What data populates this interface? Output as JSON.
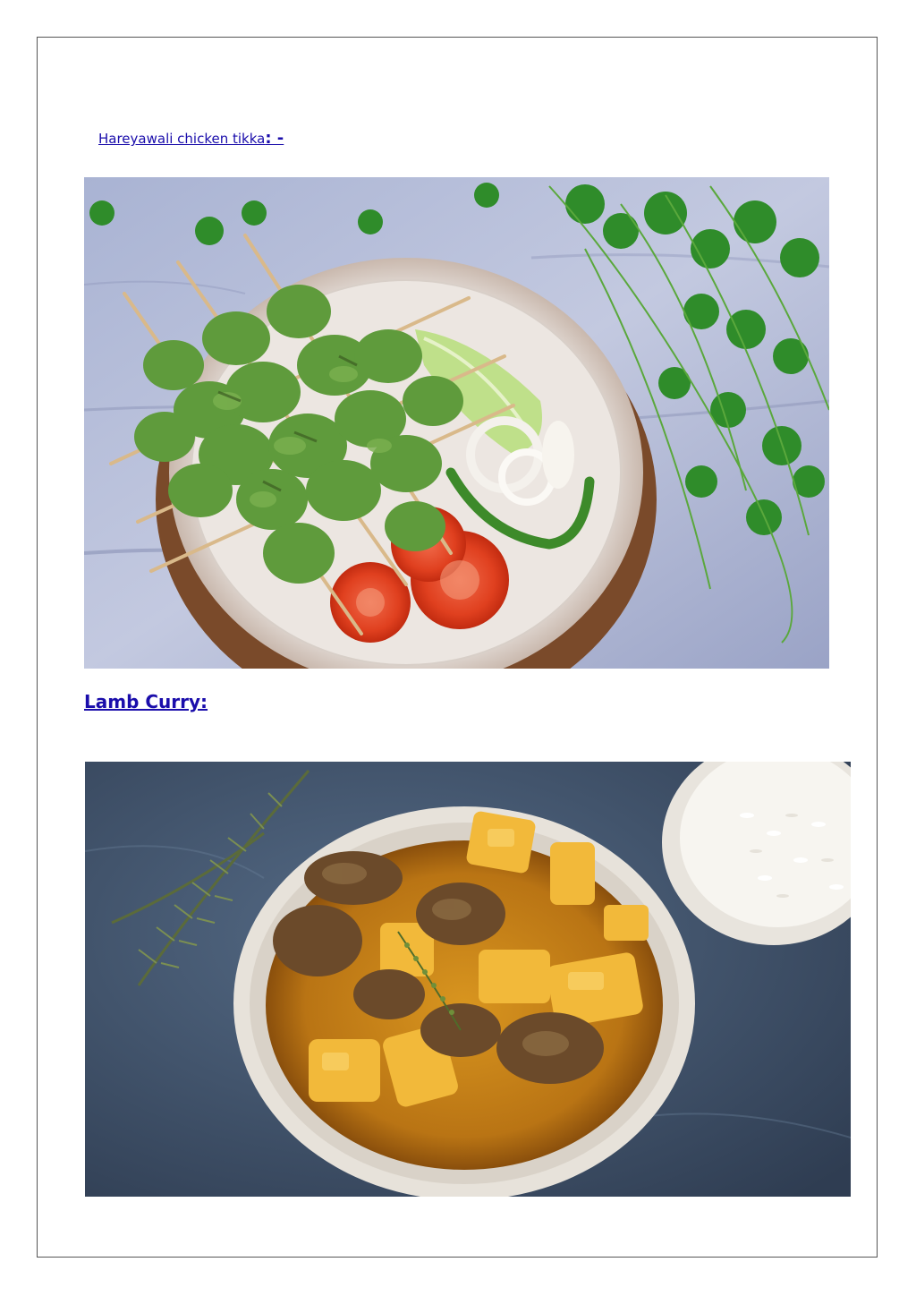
{
  "sections": {
    "tikka_link": {
      "label": "Hareyawali chicken tikka",
      "separator": ": -"
    },
    "lamb_heading": {
      "label": "Lamb Curry:"
    }
  },
  "colors": {
    "link": "#1a0dab",
    "border": "#555555"
  }
}
